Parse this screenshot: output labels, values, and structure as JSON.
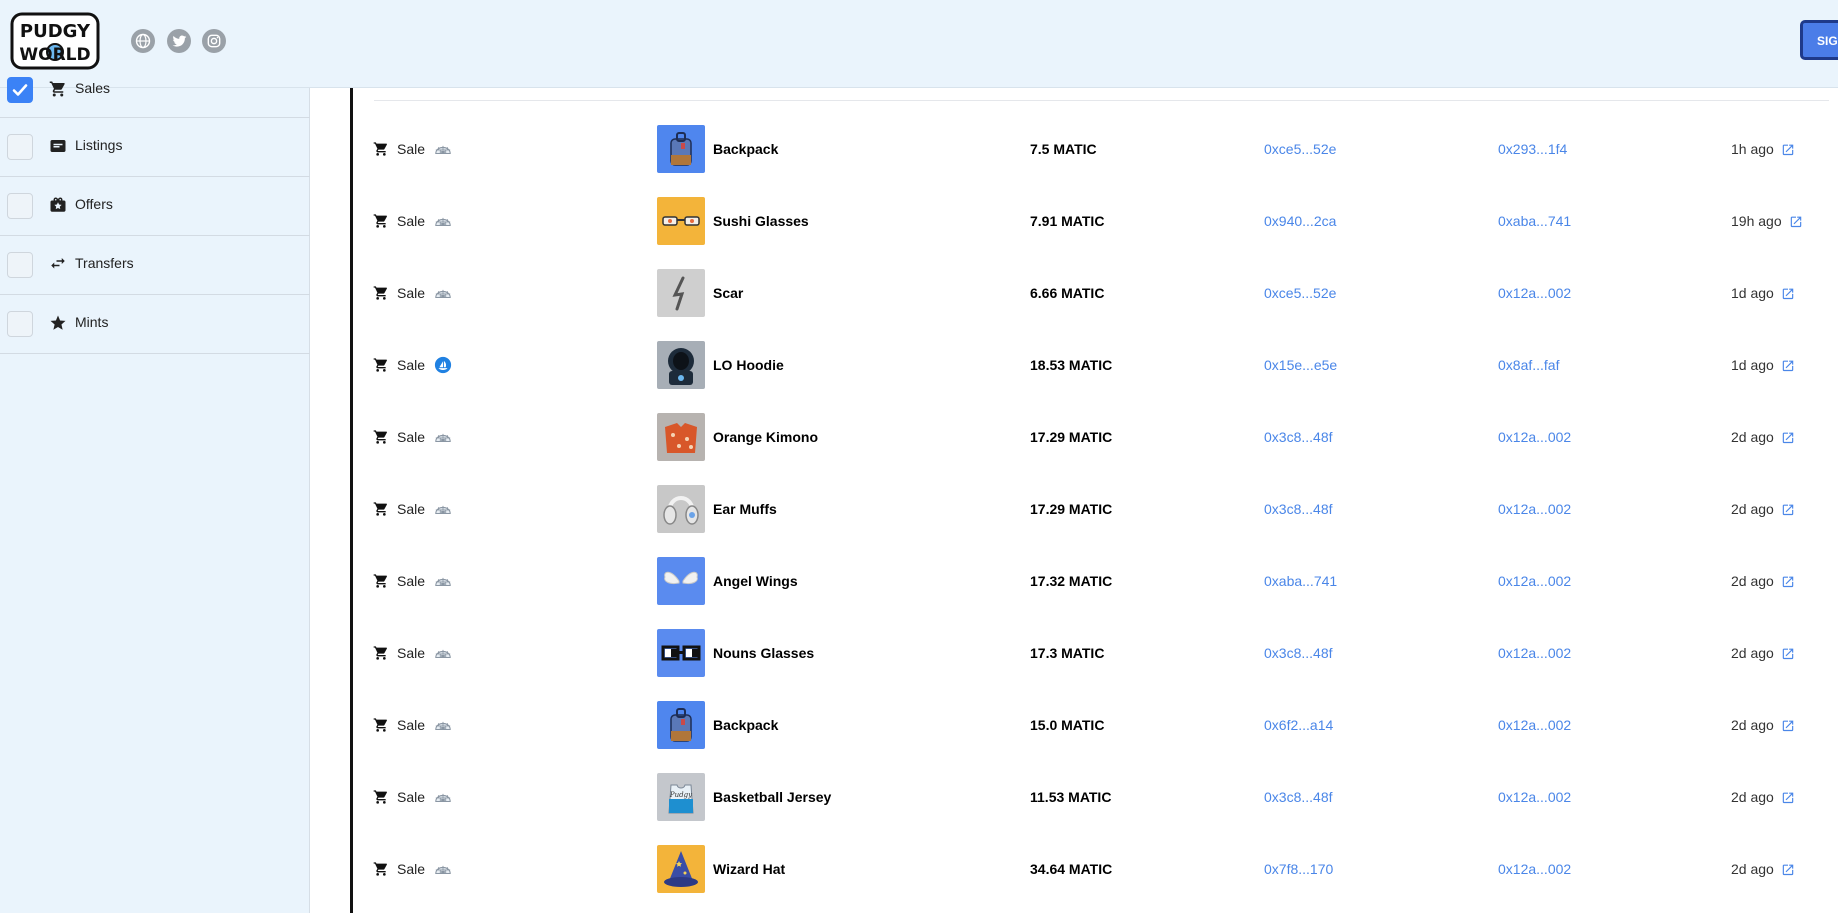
{
  "header": {
    "logo_text_top": "PUDGY",
    "logo_text_bottom": "WORLD",
    "social_icons": [
      "globe-icon",
      "twitter-icon",
      "instagram-icon"
    ],
    "signin_label": "SIGN"
  },
  "colors": {
    "header_bg": "#eaf4fc",
    "accent_blue": "#4a86e8",
    "checkbox_checked": "#3b82f6"
  },
  "sidebar": {
    "filters": [
      {
        "label": "Sales",
        "icon": "cart-icon",
        "checked": true
      },
      {
        "label": "Listings",
        "icon": "listing-icon",
        "checked": false
      },
      {
        "label": "Offers",
        "icon": "offer-icon",
        "checked": false
      },
      {
        "label": "Transfers",
        "icon": "transfer-icon",
        "checked": false
      },
      {
        "label": "Mints",
        "icon": "star-icon",
        "checked": false
      }
    ]
  },
  "activity": {
    "rows": [
      {
        "type": "Sale",
        "chain": "igloo",
        "item": "Backpack",
        "thumb": "backpack",
        "price": "7.5 MATIC",
        "from": "0xce5...52e",
        "to": "0x293...1f4",
        "time": "1h ago"
      },
      {
        "type": "Sale",
        "chain": "igloo",
        "item": "Sushi Glasses",
        "thumb": "sushi-glasses",
        "price": "7.91 MATIC",
        "from": "0x940...2ca",
        "to": "0xaba...741",
        "time": "19h ago"
      },
      {
        "type": "Sale",
        "chain": "igloo",
        "item": "Scar",
        "thumb": "scar",
        "price": "6.66 MATIC",
        "from": "0xce5...52e",
        "to": "0x12a...002",
        "time": "1d ago"
      },
      {
        "type": "Sale",
        "chain": "opensea",
        "item": "LO Hoodie",
        "thumb": "hoodie",
        "price": "18.53 MATIC",
        "from": "0x15e...e5e",
        "to": "0x8af...faf",
        "time": "1d ago"
      },
      {
        "type": "Sale",
        "chain": "igloo",
        "item": "Orange Kimono",
        "thumb": "kimono",
        "price": "17.29 MATIC",
        "from": "0x3c8...48f",
        "to": "0x12a...002",
        "time": "2d ago"
      },
      {
        "type": "Sale",
        "chain": "igloo",
        "item": "Ear Muffs",
        "thumb": "earmuffs",
        "price": "17.29 MATIC",
        "from": "0x3c8...48f",
        "to": "0x12a...002",
        "time": "2d ago"
      },
      {
        "type": "Sale",
        "chain": "igloo",
        "item": "Angel Wings",
        "thumb": "wings",
        "price": "17.32 MATIC",
        "from": "0xaba...741",
        "to": "0x12a...002",
        "time": "2d ago"
      },
      {
        "type": "Sale",
        "chain": "igloo",
        "item": "Nouns Glasses",
        "thumb": "nouns",
        "price": "17.3 MATIC",
        "from": "0x3c8...48f",
        "to": "0x12a...002",
        "time": "2d ago"
      },
      {
        "type": "Sale",
        "chain": "igloo",
        "item": "Backpack",
        "thumb": "backpack",
        "price": "15.0 MATIC",
        "from": "0x6f2...a14",
        "to": "0x12a...002",
        "time": "2d ago"
      },
      {
        "type": "Sale",
        "chain": "igloo",
        "item": "Basketball Jersey",
        "thumb": "jersey",
        "price": "11.53 MATIC",
        "from": "0x3c8...48f",
        "to": "0x12a...002",
        "time": "2d ago"
      },
      {
        "type": "Sale",
        "chain": "igloo",
        "item": "Wizard Hat",
        "thumb": "wizard-hat",
        "price": "34.64 MATIC",
        "from": "0x7f8...170",
        "to": "0x12a...002",
        "time": "2d ago"
      }
    ]
  }
}
